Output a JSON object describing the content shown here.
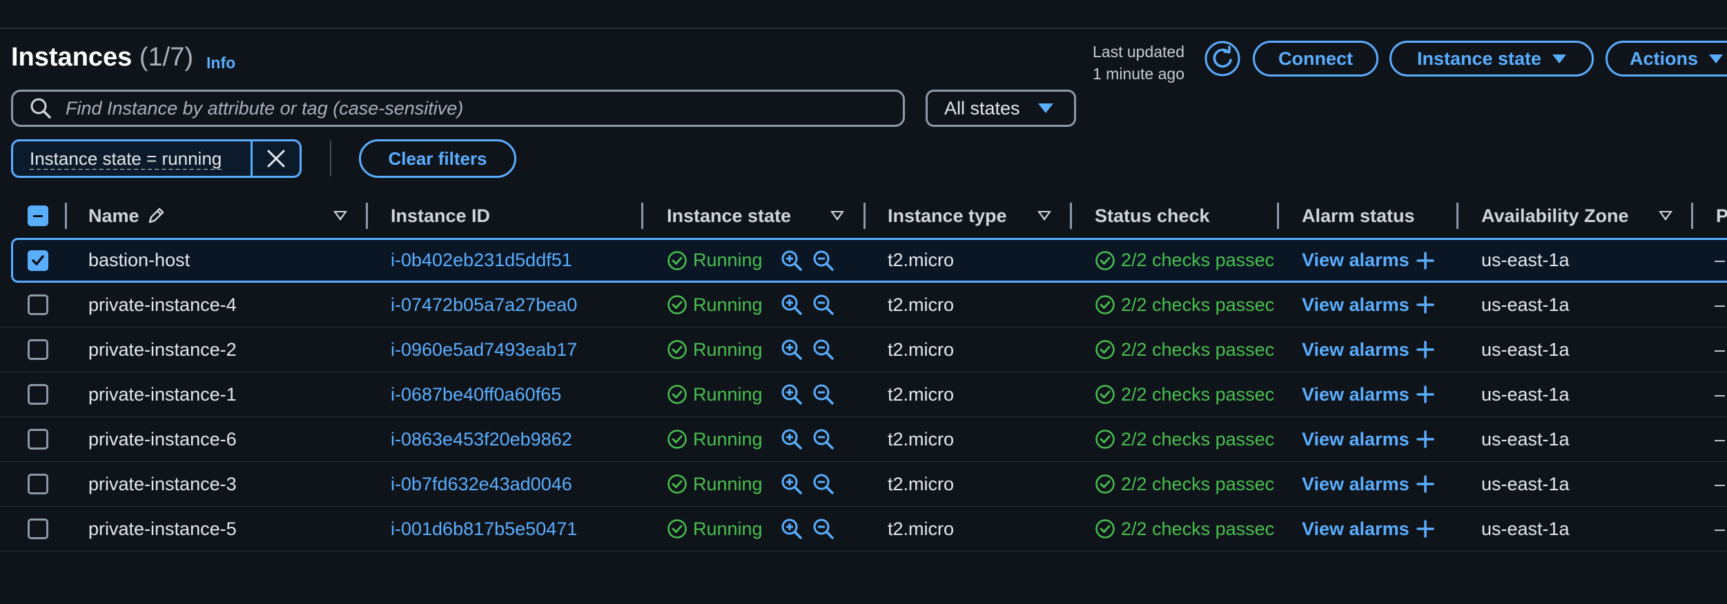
{
  "header": {
    "title": "Instances",
    "count": "(1/7)",
    "info": "Info",
    "last_updated_line1": "Last updated",
    "last_updated_line2": "1 minute ago",
    "connect": "Connect",
    "instance_state": "Instance state",
    "actions": "Actions"
  },
  "search": {
    "placeholder": "Find Instance by attribute or tag (case-sensitive)",
    "value": ""
  },
  "state_filter": {
    "selected": "All states"
  },
  "filter_token": {
    "label": "Instance state = running"
  },
  "clear_filters": "Clear filters",
  "columns": {
    "name": "Name",
    "instance_id": "Instance ID",
    "instance_state": "Instance state",
    "instance_type": "Instance type",
    "status_check": "Status check",
    "alarm_status": "Alarm status",
    "availability_zone": "Availability Zone",
    "public_partial": "P"
  },
  "rows": [
    {
      "name": "bastion-host",
      "id": "i-0b402eb231d5ddf51",
      "state": "Running",
      "type": "t2.micro",
      "status": "2/2 checks passec",
      "alarms": "View alarms",
      "az": "us-east-1a",
      "extra": "–",
      "selected": true
    },
    {
      "name": "private-instance-4",
      "id": "i-07472b05a7a27bea0",
      "state": "Running",
      "type": "t2.micro",
      "status": "2/2 checks passec",
      "alarms": "View alarms",
      "az": "us-east-1a",
      "extra": "–",
      "selected": false
    },
    {
      "name": "private-instance-2",
      "id": "i-0960e5ad7493eab17",
      "state": "Running",
      "type": "t2.micro",
      "status": "2/2 checks passec",
      "alarms": "View alarms",
      "az": "us-east-1a",
      "extra": "–",
      "selected": false
    },
    {
      "name": "private-instance-1",
      "id": "i-0687be40ff0a60f65",
      "state": "Running",
      "type": "t2.micro",
      "status": "2/2 checks passec",
      "alarms": "View alarms",
      "az": "us-east-1a",
      "extra": "–",
      "selected": false
    },
    {
      "name": "private-instance-6",
      "id": "i-0863e453f20eb9862",
      "state": "Running",
      "type": "t2.micro",
      "status": "2/2 checks passec",
      "alarms": "View alarms",
      "az": "us-east-1a",
      "extra": "–",
      "selected": false
    },
    {
      "name": "private-instance-3",
      "id": "i-0b7fd632e43ad0046",
      "state": "Running",
      "type": "t2.micro",
      "status": "2/2 checks passec",
      "alarms": "View alarms",
      "az": "us-east-1a",
      "extra": "–",
      "selected": false
    },
    {
      "name": "private-instance-5",
      "id": "i-001d6b817b5e50471",
      "state": "Running",
      "type": "t2.micro",
      "status": "2/2 checks passec",
      "alarms": "View alarms",
      "az": "us-east-1a",
      "extra": "–",
      "selected": false
    }
  ],
  "colors": {
    "accent": "#5aaeff",
    "success": "#48c04f",
    "background": "#0f141a"
  }
}
